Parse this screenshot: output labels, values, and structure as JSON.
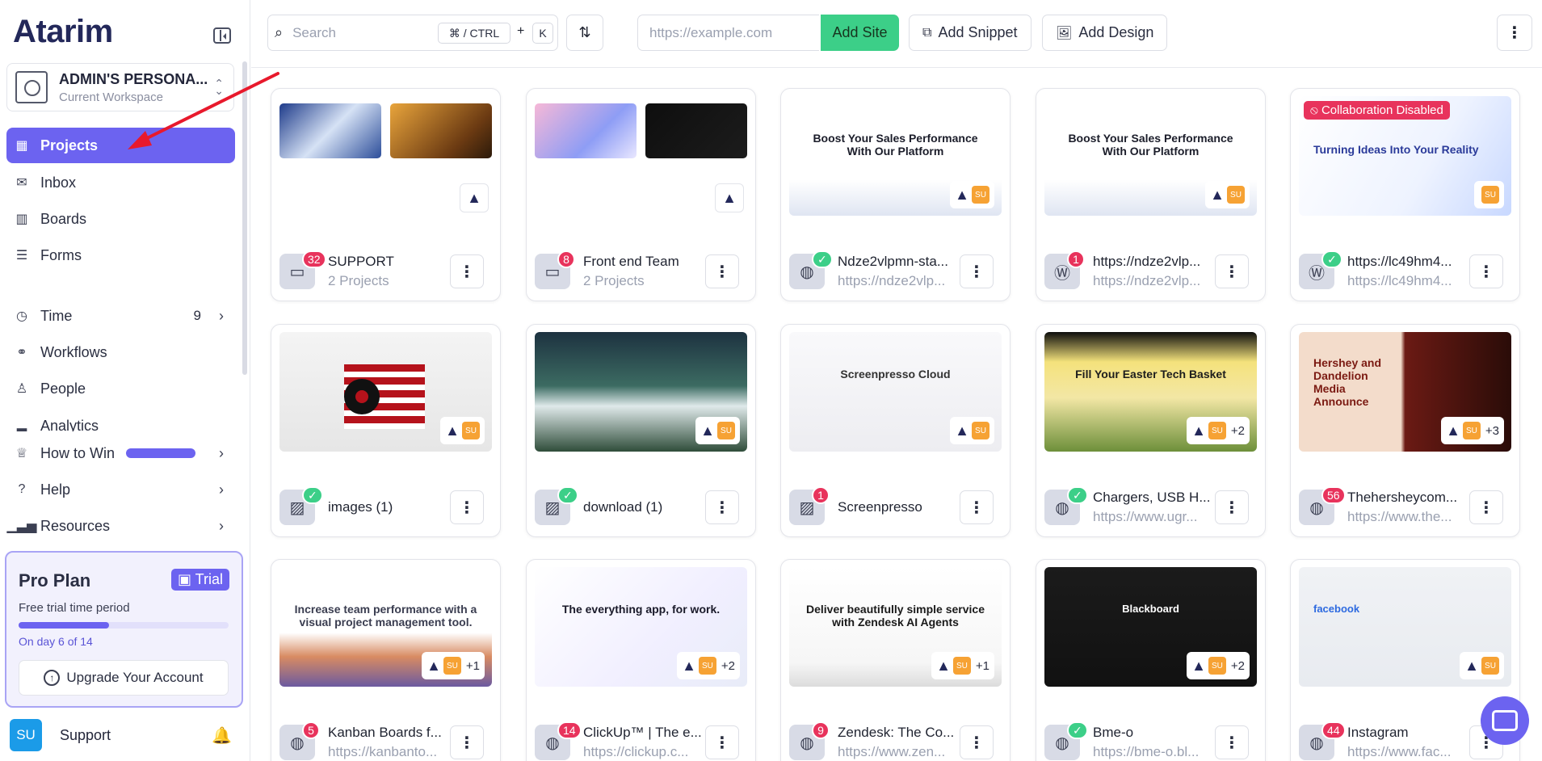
{
  "brand": {
    "logo_text": "Atarim"
  },
  "workspace": {
    "name": "ADMIN'S PERSONA...",
    "subtitle": "Current Workspace"
  },
  "nav": {
    "projects": "Projects",
    "inbox": "Inbox",
    "boards": "Boards",
    "forms": "Forms",
    "time": "Time",
    "time_count": "9",
    "workflows": "Workflows",
    "people": "People",
    "analytics": "Analytics",
    "how_to_win": "How to Win",
    "help": "Help",
    "resources": "Resources"
  },
  "plan": {
    "title": "Pro Plan",
    "badge": "Trial",
    "subtitle": "Free trial time period",
    "progress": 0.43,
    "day_text": "On day 6 of 14",
    "upgrade_label": "Upgrade Your Account"
  },
  "user": {
    "initials": "SU",
    "name": "Support"
  },
  "toolbar": {
    "search_placeholder": "Search",
    "shortcut_ctrl": "⌘ / CTRL",
    "shortcut_plus": "+",
    "shortcut_k": "K",
    "url_placeholder": "https://example.com",
    "add_site": "Add Site",
    "add_snippet": "Add Snippet",
    "add_design": "Add Design"
  },
  "cards": [
    {
      "title": "SUPPORT",
      "subtitle": "2 Projects",
      "badge": "32",
      "type": "folder-icon"
    },
    {
      "title": "Front end Team",
      "subtitle": "2 Projects",
      "badge": "8",
      "type": "folder-icon"
    },
    {
      "title": "Ndze2vlpmn-sta...",
      "subtitle": "https://ndze2vlp...",
      "badge": "✓",
      "type": "globe-icon"
    },
    {
      "title": "https://ndze2vlp...",
      "subtitle": "https://ndze2vlp...",
      "badge": "1",
      "type": "wordpress-icon"
    },
    {
      "title": "https://lc49hm4...",
      "subtitle": "https://lc49hm4...",
      "badge": "✓",
      "type": "wordpress-icon",
      "overlay_text": "Collaboration Disabled"
    },
    {
      "title": "images (1)",
      "subtitle": "",
      "badge": "✓",
      "type": "image-icon"
    },
    {
      "title": "download (1)",
      "subtitle": "",
      "badge": "✓",
      "type": "image-icon"
    },
    {
      "title": "Screenpresso",
      "subtitle": "",
      "badge": "1",
      "type": "image-icon"
    },
    {
      "title": "Chargers, USB H...",
      "subtitle": "https://www.ugr...",
      "badge": "✓",
      "type": "globe-icon",
      "extra": "+2"
    },
    {
      "title": "Thehersheycom...",
      "subtitle": "https://www.the...",
      "badge": "56",
      "type": "globe-icon",
      "extra": "+3"
    },
    {
      "title": "Kanban Boards f...",
      "subtitle": "https://kanbanto...",
      "badge": "5",
      "type": "globe-icon",
      "extra": "+1"
    },
    {
      "title": "ClickUp™ | The e...",
      "subtitle": "https://clickup.c...",
      "badge": "14",
      "type": "globe-icon",
      "extra": "+2"
    },
    {
      "title": "Zendesk: The Co...",
      "subtitle": "https://www.zen...",
      "badge": "9",
      "type": "globe-icon",
      "extra": "+1"
    },
    {
      "title": "Bme-o",
      "subtitle": "https://bme-o.bl...",
      "badge": "✓",
      "type": "globe-icon",
      "extra": "+2"
    },
    {
      "title": "Instagram",
      "subtitle": "https://www.fac...",
      "badge": "44",
      "type": "globe-icon"
    }
  ],
  "thumbs": {
    "c3": "Boost Your Sales Performance With Our Platform",
    "c4": "Boost Your Sales Performance With Our Platform",
    "c5": "Turning Ideas Into Your Reality",
    "c8": "Screenpresso Cloud",
    "c9": "Fill Your Easter Tech Basket",
    "c10": "Hershey and Dandelion Media Announce HERSHEY Major Motion Picture",
    "c11": "Increase team performance with a visual project management tool.",
    "c12": "The everything app, for work.",
    "c13": "Deliver beautifully simple service with Zendesk AI Agents",
    "c14": "Blackboard",
    "c15": "facebook"
  }
}
